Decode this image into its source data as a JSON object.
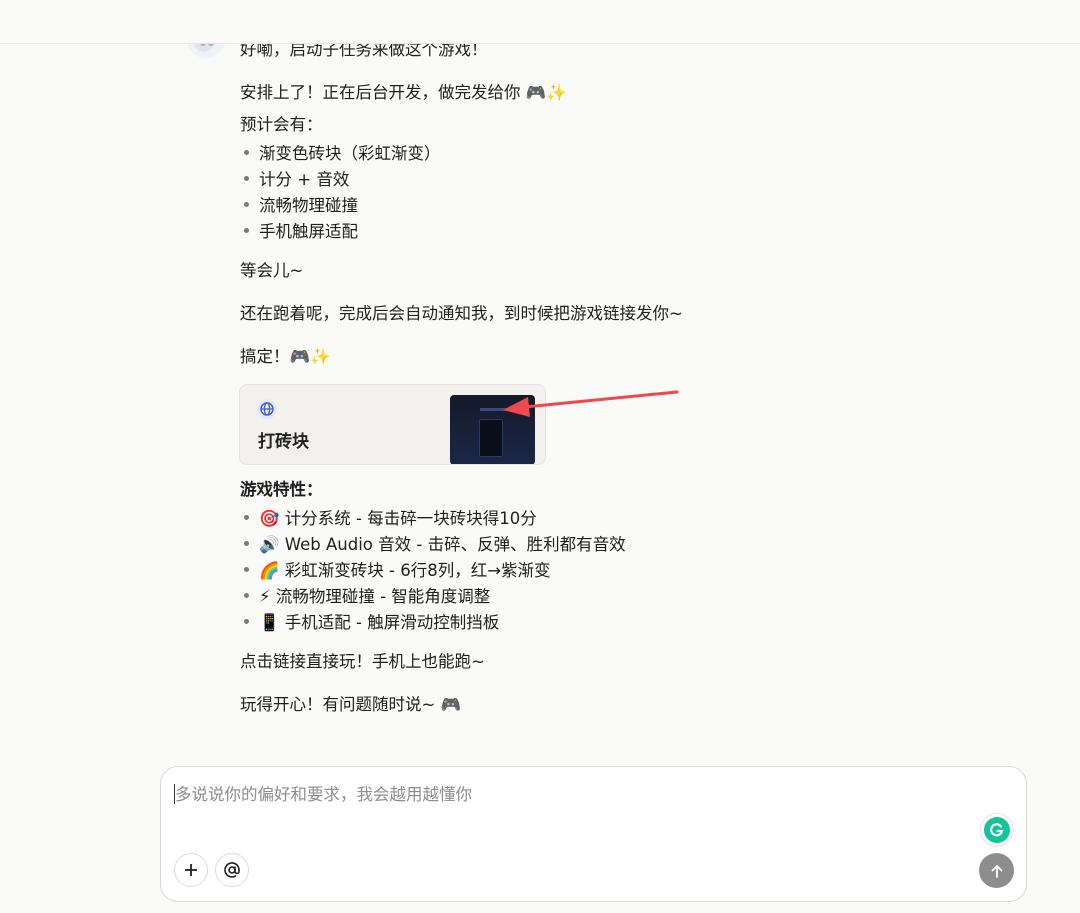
{
  "message": {
    "partial_top": "好嘞，启动子任务来做这个游戏！",
    "intro": "安排上了！正在后台开发，做完发给你 🎮✨",
    "plan_heading": "预计会有：",
    "plan_items": [
      "渐变色砖块（彩虹渐变）",
      "计分 + 音效",
      "流畅物理碰撞",
      "手机触屏适配"
    ],
    "wait": "等会儿~",
    "running": "还在跑着呢，完成后会自动通知我，到时候把游戏链接发你~",
    "done": "搞定！🎮✨",
    "features_heading": "游戏特性：",
    "features": [
      "🎯 计分系统 - 每击碎一块砖块得10分",
      "🔊 Web Audio 音效 - 击碎、反弹、胜利都有音效",
      "🌈 彩虹渐变砖块 - 6行8列，红→紫渐变",
      "⚡ 流畅物理碰撞 - 智能角度调整",
      "📱 手机适配 - 触屏滑动控制挡板"
    ],
    "click_hint": "点击链接直接玩！手机上也能跑~",
    "closing": "玩得开心！有问题随时说~ 🎮"
  },
  "link_card": {
    "icon": "globe-icon",
    "title": "打砖块"
  },
  "composer": {
    "placeholder": "多说说你的偏好和要求，我会越用越懂你",
    "add_icon": "plus-icon",
    "mention_icon": "at-icon",
    "send_icon": "arrow-up-icon"
  },
  "colors": {
    "annotation_arrow": "#f0484f",
    "send_button": "#8d8d8d",
    "grammarly": "#15c39a"
  }
}
